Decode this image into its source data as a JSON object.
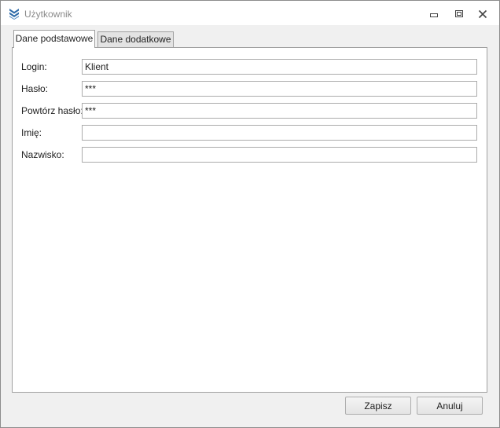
{
  "window": {
    "title": "Użytkownik",
    "icon": "chevrons-down-icon"
  },
  "tabs": [
    {
      "label": "Dane podstawowe",
      "active": true
    },
    {
      "label": "Dane dodatkowe",
      "active": false
    }
  ],
  "form": {
    "login": {
      "label": "Login:",
      "value": "Klient"
    },
    "password": {
      "label": "Hasło:",
      "value": "***"
    },
    "password_repeat": {
      "label": "Powtórz hasło:",
      "value": "***"
    },
    "first_name": {
      "label": "Imię:",
      "value": ""
    },
    "last_name": {
      "label": "Nazwisko:",
      "value": ""
    }
  },
  "buttons": {
    "save": "Zapisz",
    "cancel": "Anuluj"
  },
  "colors": {
    "app_icon": "#2e6aa8",
    "window_bg": "#f0f0f0",
    "panel_bg": "#ffffff"
  }
}
